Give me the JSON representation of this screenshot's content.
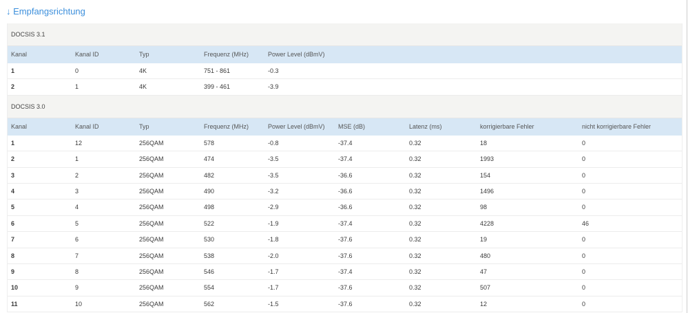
{
  "title": "↓ Empfangsrichtung",
  "docsis31": {
    "label": "DOCSIS 3.1",
    "columns": [
      "Kanal",
      "Kanal ID",
      "Typ",
      "Frequenz (MHz)",
      "Power Level (dBmV)"
    ],
    "rows": [
      [
        "1",
        "0",
        "4K",
        "751 - 861",
        "-0.3"
      ],
      [
        "2",
        "1",
        "4K",
        "399 - 461",
        "-3.9"
      ]
    ]
  },
  "docsis30": {
    "label": "DOCSIS 3.0",
    "columns": [
      "Kanal",
      "Kanal ID",
      "Typ",
      "Frequenz (MHz)",
      "Power Level (dBmV)",
      "MSE (dB)",
      "Latenz (ms)",
      "korrigierbare Fehler",
      "nicht korrigierbare Fehler"
    ],
    "rows": [
      [
        "1",
        "12",
        "256QAM",
        "578",
        "-0.8",
        "-37.4",
        "0.32",
        "18",
        "0"
      ],
      [
        "2",
        "1",
        "256QAM",
        "474",
        "-3.5",
        "-37.4",
        "0.32",
        "1993",
        "0"
      ],
      [
        "3",
        "2",
        "256QAM",
        "482",
        "-3.5",
        "-36.6",
        "0.32",
        "154",
        "0"
      ],
      [
        "4",
        "3",
        "256QAM",
        "490",
        "-3.2",
        "-36.6",
        "0.32",
        "1496",
        "0"
      ],
      [
        "5",
        "4",
        "256QAM",
        "498",
        "-2.9",
        "-36.6",
        "0.32",
        "98",
        "0"
      ],
      [
        "6",
        "5",
        "256QAM",
        "522",
        "-1.9",
        "-37.4",
        "0.32",
        "4228",
        "46"
      ],
      [
        "7",
        "6",
        "256QAM",
        "530",
        "-1.8",
        "-37.6",
        "0.32",
        "19",
        "0"
      ],
      [
        "8",
        "7",
        "256QAM",
        "538",
        "-2.0",
        "-37.6",
        "0.32",
        "480",
        "0"
      ],
      [
        "9",
        "8",
        "256QAM",
        "546",
        "-1.7",
        "-37.4",
        "0.32",
        "47",
        "0"
      ],
      [
        "10",
        "9",
        "256QAM",
        "554",
        "-1.7",
        "-37.6",
        "0.32",
        "507",
        "0"
      ],
      [
        "11",
        "10",
        "256QAM",
        "562",
        "-1.5",
        "-37.6",
        "0.32",
        "12",
        "0"
      ]
    ]
  }
}
